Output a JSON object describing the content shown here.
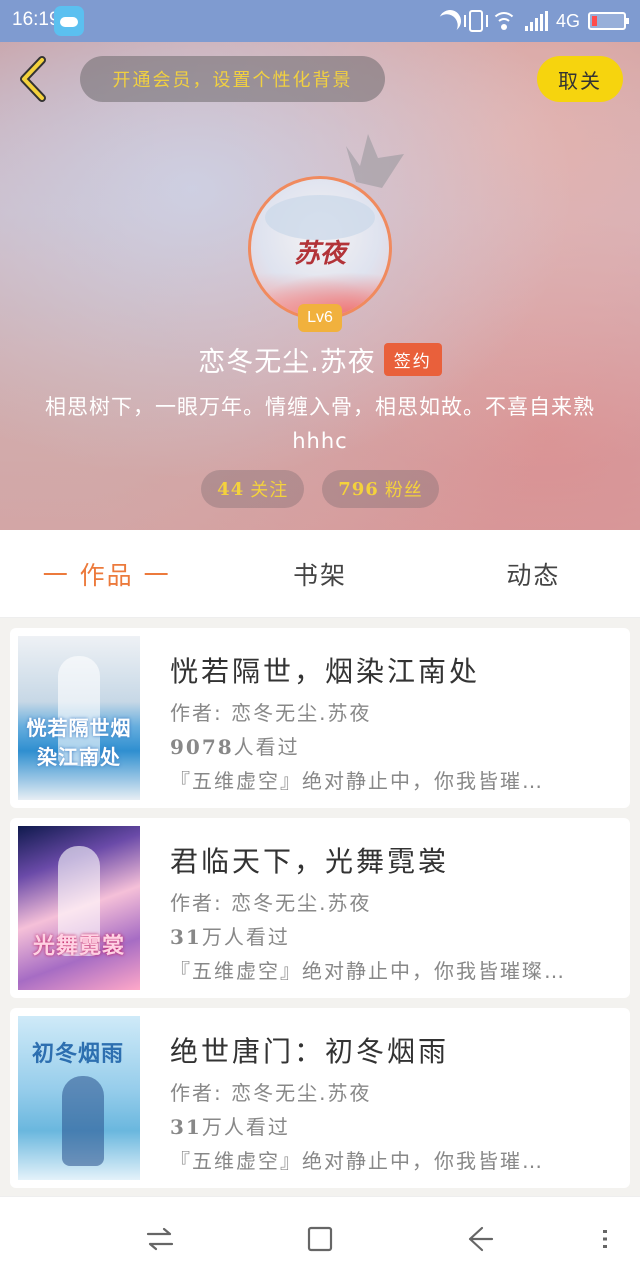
{
  "status_bar": {
    "time": "16:19",
    "network": "4G"
  },
  "header": {
    "vip_banner": "开通会员，设置个性化背景",
    "unfollow_label": "取关",
    "avatar_text": "苏夜",
    "level": "Lv6",
    "username": "恋冬无尘.苏夜",
    "signed_badge": "签约",
    "bio": "相思树下，一眼万年。情缠入骨，相思如故。不喜自来熟hhhc",
    "following_count": "44",
    "following_label": "关注",
    "followers_count": "796",
    "followers_label": "粉丝"
  },
  "tabs": [
    {
      "label": "一 作品 一",
      "active": true
    },
    {
      "label": "书架",
      "active": false
    },
    {
      "label": "动态",
      "active": false
    }
  ],
  "books": [
    {
      "title": "恍若隔世，烟染江南处",
      "author": "作者: 恋冬无尘.苏夜",
      "views_num": "9078",
      "views_unit": "人看过",
      "desc": "『五维虚空』绝对静止中，你我皆璀…",
      "cover_text": "恍若隔世烟染江南处"
    },
    {
      "title": "君临天下，光舞霓裳",
      "author": "作者: 恋冬无尘.苏夜",
      "views_num": "31",
      "views_unit": "万人看过",
      "desc": "『五维虚空』绝对静止中，你我皆璀璨…",
      "cover_text": "光舞霓裳"
    },
    {
      "title": "绝世唐门：初冬烟雨",
      "author": "作者: 恋冬无尘.苏夜",
      "views_num": "31",
      "views_unit": "万人看过",
      "desc": "『五维虚空』绝对静止中，你我皆璀…",
      "cover_text": "初冬烟雨"
    }
  ],
  "colors": {
    "accent": "#ec7a3c",
    "gold": "#f4d23c",
    "unfollow_bg": "#f6d40e",
    "status_bar": "#7f9bd0"
  }
}
